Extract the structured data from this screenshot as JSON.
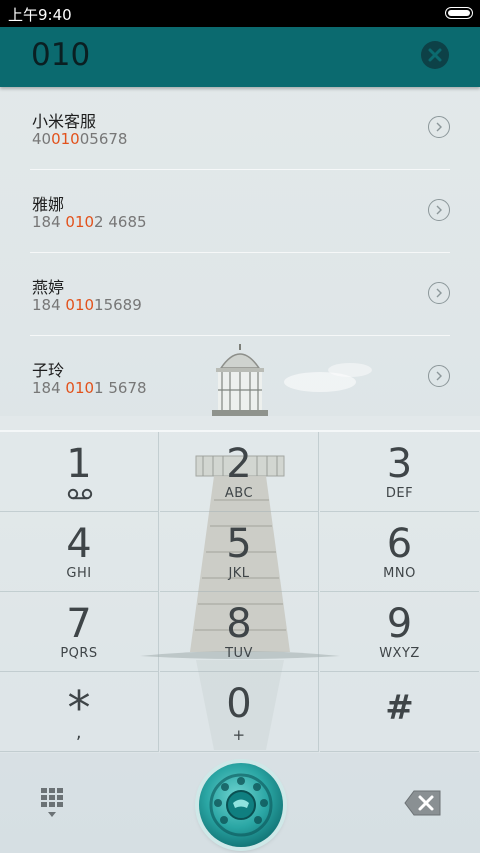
{
  "status_bar": {
    "time": "上午9:40"
  },
  "search": {
    "query": "010"
  },
  "contacts": [
    {
      "name": "小米客服",
      "number_pre": "40",
      "number_match": "010",
      "number_post": "05678"
    },
    {
      "name": "雅娜",
      "number_pre": "184 ",
      "number_match": "010",
      "number_post": "2 4685"
    },
    {
      "name": "燕婷",
      "number_pre": "184 ",
      "number_match": "010",
      "number_post": "15689"
    },
    {
      "name": "子玲",
      "number_pre": "184 ",
      "number_match": "010",
      "number_post": "1 5678"
    }
  ],
  "keypad": {
    "keys": [
      {
        "digit": "1",
        "letters": ""
      },
      {
        "digit": "2",
        "letters": "ABC"
      },
      {
        "digit": "3",
        "letters": "DEF"
      },
      {
        "digit": "4",
        "letters": "GHI"
      },
      {
        "digit": "5",
        "letters": "JKL"
      },
      {
        "digit": "6",
        "letters": "MNO"
      },
      {
        "digit": "7",
        "letters": "PQRS"
      },
      {
        "digit": "8",
        "letters": "TUV"
      },
      {
        "digit": "9",
        "letters": "WXYZ"
      },
      {
        "digit": "*",
        "letters": ","
      },
      {
        "digit": "0",
        "letters": "+"
      },
      {
        "digit": "#",
        "letters": ""
      }
    ]
  },
  "icons": {
    "voicemail": "voicemail-icon",
    "clear": "close-icon",
    "detail": "chevron-right-icon",
    "dialpad": "dialpad-icon",
    "call": "rotary-phone-icon",
    "backspace": "backspace-icon"
  },
  "colors": {
    "header": "#0b6a6f",
    "match_highlight": "#e2521c",
    "call_button": "#2aa6a4"
  }
}
